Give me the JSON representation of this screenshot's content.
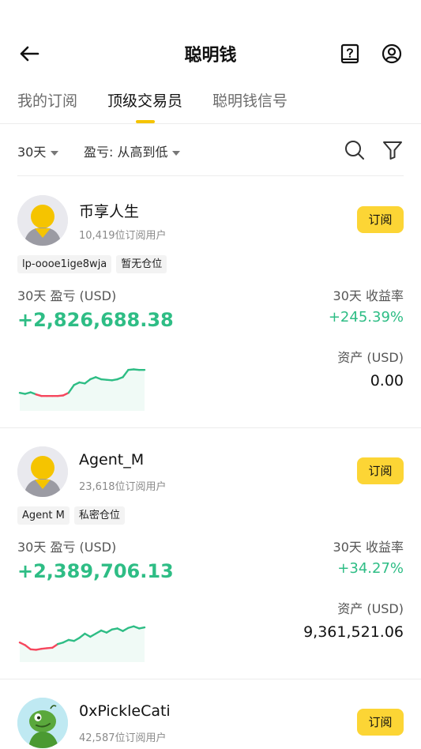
{
  "header": {
    "title": "聪明钱",
    "back_icon": "back-arrow-icon",
    "help_icon": "help-book-icon",
    "user_icon": "user-circle-icon"
  },
  "tabs": [
    {
      "label": "我的订阅",
      "active": false
    },
    {
      "label": "顶级交易员",
      "active": true
    },
    {
      "label": "聪明钱信号",
      "active": false
    }
  ],
  "filters": {
    "days": "30天",
    "sort": "盈亏: 从高到低",
    "search_icon": "search-icon",
    "filter_icon": "filter-icon"
  },
  "labels": {
    "pnl": "30天 盈亏 (USD)",
    "roi": "30天 收益率",
    "assets": "资产 (USD)",
    "subscribe": "订阅"
  },
  "colors": {
    "accent": "#fcd535",
    "positive": "#2ebd85",
    "negative": "#f6465d"
  },
  "traders": [
    {
      "name": "币享人生",
      "subscribers": "10,419位订阅用户",
      "tags": [
        "lp-oooe1ige8wja",
        "暂无仓位"
      ],
      "pnl": "+2,826,688.38",
      "roi": "+245.39%",
      "assets": "0.00",
      "avatar": "default-avatar",
      "trend": [
        0.3,
        0.28,
        0.31,
        0.27,
        0.24,
        0.24,
        0.24,
        0.24,
        0.25,
        0.3,
        0.45,
        0.5,
        0.48,
        0.56,
        0.6,
        0.56,
        0.55,
        0.54,
        0.56,
        0.6,
        0.74,
        0.75,
        0.74,
        0.74
      ]
    },
    {
      "name": "Agent_M",
      "subscribers": "23,618位订阅用户",
      "tags": [
        "Agent M",
        "私密仓位"
      ],
      "pnl": "+2,389,706.13",
      "roi": "+34.27%",
      "assets": "9,361,521.06",
      "avatar": "default-avatar",
      "trend": [
        0.33,
        0.28,
        0.2,
        0.19,
        0.21,
        0.22,
        0.23,
        0.3,
        0.33,
        0.38,
        0.36,
        0.42,
        0.5,
        0.44,
        0.5,
        0.56,
        0.52,
        0.58,
        0.6,
        0.55,
        0.61,
        0.64,
        0.6,
        0.62
      ]
    },
    {
      "name": "0xPickleCati",
      "subscribers": "42,587位订阅用户",
      "tags": [],
      "pnl": "",
      "roi": "",
      "assets": "",
      "avatar": "pickle-cat-avatar",
      "trend": []
    }
  ]
}
